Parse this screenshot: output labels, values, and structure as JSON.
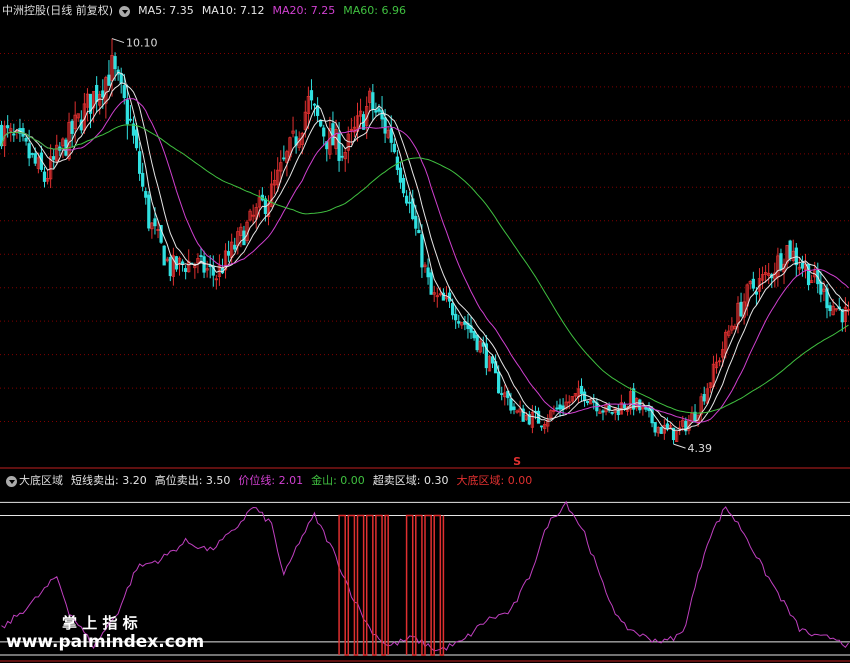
{
  "top_legend": {
    "title": "中洲控股(日线 前复权)",
    "items": [
      {
        "label": "MA5: 7.35",
        "color": "#e6e6e6"
      },
      {
        "label": "MA10: 7.12",
        "color": "#e6e6e6"
      },
      {
        "label": "MA20: 7.25",
        "color": "#d040d0"
      },
      {
        "label": "MA60: 6.96",
        "color": "#40c040"
      }
    ]
  },
  "bottom_legend": {
    "title": "大底区域",
    "items": [
      {
        "label": "短线卖出: 3.20",
        "color": "#e6e6e6"
      },
      {
        "label": "高位卖出: 3.50",
        "color": "#e6e6e6"
      },
      {
        "label": "价位线: 2.01",
        "color": "#d040d0"
      },
      {
        "label": "金山: 0.00",
        "color": "#40c040"
      },
      {
        "label": "超卖区域: 0.30",
        "color": "#e6e6e6"
      },
      {
        "label": "大底区域: 0.00",
        "color": "#e03030"
      }
    ]
  },
  "annotations": {
    "high_label": "10.10",
    "low_label": "4.39",
    "signal_label": "S"
  },
  "watermark": {
    "line1": "掌 上 指 标",
    "line2": "www.palmindex.com"
  },
  "colors": {
    "up": "#e03030",
    "down": "#30e0e0",
    "ma5": "#e6e6e6",
    "ma10": "#e6e6e6",
    "ma20": "#d040d0",
    "ma60": "#40c040",
    "osc": "#c040c0",
    "bottom": "#e03030",
    "grid": "#800000"
  },
  "chart_data": {
    "type": "candlestick",
    "price_range": [
      4.2,
      10.5
    ],
    "high_value": 10.1,
    "low_value": 4.39,
    "keypoints": [
      [
        0,
        8.9
      ],
      [
        8,
        8.6
      ],
      [
        14,
        8.2
      ],
      [
        22,
        8.8
      ],
      [
        30,
        9.4
      ],
      [
        36,
        9.8
      ],
      [
        42,
        9.0
      ],
      [
        48,
        7.6
      ],
      [
        55,
        6.9
      ],
      [
        62,
        7.0
      ],
      [
        70,
        6.8
      ],
      [
        80,
        7.5
      ],
      [
        88,
        8.0
      ],
      [
        95,
        8.7
      ],
      [
        100,
        9.3
      ],
      [
        106,
        8.8
      ],
      [
        112,
        8.6
      ],
      [
        120,
        9.3
      ],
      [
        127,
        8.8
      ],
      [
        132,
        8.0
      ],
      [
        140,
        6.5
      ],
      [
        148,
        6.3
      ],
      [
        156,
        5.8
      ],
      [
        162,
        5.2
      ],
      [
        168,
        4.8
      ],
      [
        176,
        4.7
      ],
      [
        182,
        4.9
      ],
      [
        190,
        5.1
      ],
      [
        198,
        4.8
      ],
      [
        205,
        5.0
      ],
      [
        214,
        4.6
      ],
      [
        220,
        4.5
      ],
      [
        226,
        4.8
      ],
      [
        232,
        5.4
      ],
      [
        238,
        6.1
      ],
      [
        244,
        6.6
      ],
      [
        250,
        6.8
      ],
      [
        256,
        7.2
      ],
      [
        262,
        6.9
      ],
      [
        270,
        6.4
      ],
      [
        276,
        6.2
      ]
    ],
    "bottom_indicator": {
      "thresholds": [
        3.5,
        3.2,
        0.3,
        0.0
      ],
      "osc_range": [
        0,
        3.6
      ],
      "osc_keypoints": [
        [
          0,
          0.6
        ],
        [
          10,
          1.2
        ],
        [
          18,
          1.8
        ],
        [
          22,
          1.0
        ],
        [
          30,
          0.2
        ],
        [
          38,
          1.0
        ],
        [
          44,
          2.0
        ],
        [
          52,
          2.2
        ],
        [
          60,
          2.6
        ],
        [
          68,
          2.4
        ],
        [
          75,
          2.8
        ],
        [
          82,
          3.4
        ],
        [
          88,
          3.0
        ],
        [
          92,
          1.8
        ],
        [
          97,
          2.6
        ],
        [
          102,
          3.2
        ],
        [
          108,
          2.4
        ],
        [
          114,
          1.4
        ],
        [
          120,
          0.6
        ],
        [
          126,
          0.2
        ],
        [
          134,
          0.4
        ],
        [
          142,
          0.1
        ],
        [
          150,
          0.3
        ],
        [
          158,
          0.8
        ],
        [
          166,
          1.0
        ],
        [
          172,
          1.8
        ],
        [
          178,
          3.0
        ],
        [
          184,
          3.5
        ],
        [
          190,
          2.8
        ],
        [
          196,
          1.6
        ],
        [
          202,
          0.7
        ],
        [
          210,
          0.4
        ],
        [
          216,
          0.3
        ],
        [
          222,
          0.5
        ],
        [
          230,
          2.6
        ],
        [
          236,
          3.4
        ],
        [
          242,
          2.8
        ],
        [
          248,
          2.0
        ],
        [
          254,
          1.3
        ],
        [
          260,
          0.6
        ],
        [
          266,
          0.4
        ],
        [
          272,
          0.4
        ],
        [
          276,
          0.2
        ]
      ],
      "bottom_zone": [
        [
          110,
          126
        ],
        [
          132,
          144
        ]
      ]
    }
  }
}
